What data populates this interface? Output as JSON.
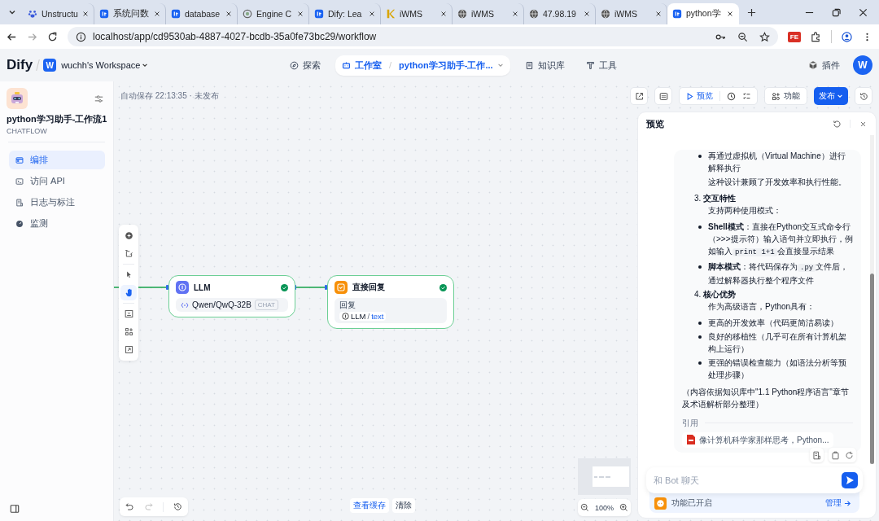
{
  "browser": {
    "tabs": [
      {
        "kind": "paw",
        "title": "Unstructu",
        "selected": false
      },
      {
        "kind": "dify",
        "title": "系统问数",
        "selected": false
      },
      {
        "kind": "dify",
        "title": "database",
        "selected": false
      },
      {
        "kind": "ring",
        "title": "Engine C",
        "selected": false
      },
      {
        "kind": "dify",
        "title": "Dify: Lea",
        "selected": false
      },
      {
        "kind": "k",
        "title": "iWMS",
        "selected": false
      },
      {
        "kind": "globe",
        "title": "iWMS",
        "selected": false
      },
      {
        "kind": "globe",
        "title": "47.98.19",
        "selected": false
      },
      {
        "kind": "globe",
        "title": "iWMS",
        "selected": false
      },
      {
        "kind": "dify",
        "title": "python学",
        "selected": true
      }
    ],
    "url": "localhost/app/cd9530ab-4887-4027-bcdb-35a0fe73bc29/workflow",
    "extension_badge": "FE"
  },
  "header": {
    "logo": "Dify",
    "workspace": {
      "initial": "W",
      "name": "wuchh's Workspace"
    },
    "nav": [
      {
        "kind": "explore",
        "label": "探索",
        "selected": false
      },
      {
        "kind": "studio",
        "label": "工作室",
        "separator": "/",
        "app": "python学习助手-工作...",
        "selected": true
      },
      {
        "kind": "knowledge",
        "label": "知识库",
        "selected": false
      },
      {
        "kind": "tools",
        "label": "工具",
        "selected": false
      }
    ],
    "plugins": "插件",
    "avatar": "W"
  },
  "sidebar": {
    "app_name": "python学习助手-工作流1",
    "app_type": "CHATFLOW",
    "items": [
      {
        "kind": "orchestrate",
        "label": "编排",
        "selected": true
      },
      {
        "kind": "api",
        "label": "访问 API",
        "selected": false
      },
      {
        "kind": "logs",
        "label": "日志与标注",
        "selected": false
      },
      {
        "kind": "monitor",
        "label": "监测",
        "selected": false
      }
    ]
  },
  "canvas": {
    "status": "自动保存 22:13:35 · 未发布",
    "actions": {
      "preview": "预览",
      "features": "功能",
      "publish": "发布"
    },
    "tools": [
      {
        "kind": "add",
        "selected": false
      },
      {
        "kind": "note",
        "selected": false
      },
      {
        "kind": "pointer",
        "selected": false
      },
      {
        "kind": "hand",
        "selected": true
      },
      {
        "kind": "export",
        "selected": false
      },
      {
        "kind": "layout",
        "selected": false
      },
      {
        "kind": "fit",
        "selected": false
      }
    ],
    "nodes": [
      {
        "kind": "llm",
        "title": "LLM",
        "valid": true,
        "model": "Qwen/QwQ-32B",
        "mode": "CHAT"
      },
      {
        "kind": "answer",
        "title": "直接回复",
        "valid": true,
        "field_label": "回复",
        "var_node": "LLM",
        "var_separator": "/",
        "var_name": "text"
      }
    ],
    "view_cache": "查看缓存",
    "clear": "清除",
    "zoom": "100%"
  },
  "preview": {
    "title": "预览",
    "blocks": [
      {
        "kind": "bullet",
        "parts": [
          {
            "kind": "text",
            "text": "再通过虚拟机（Virtual Machine）进行解释执行"
          }
        ]
      },
      {
        "kind": "text",
        "text": "这种设计兼顾了开发效率和执行性能。"
      },
      {
        "kind": "heading",
        "number": "3.",
        "text": "交互特性"
      },
      {
        "kind": "text",
        "text": "支持两种使用模式："
      },
      {
        "kind": "bullet",
        "parts": [
          {
            "kind": "text",
            "text": "**Shell模式**：直接在Python交互式命令行（>>>提示符）输入语句并立即执行，例如输入"
          },
          {
            "kind": "code",
            "text": "print 1+1"
          },
          {
            "kind": "text",
            "text": "会直接显示结果"
          }
        ]
      },
      {
        "kind": "bullet",
        "parts": [
          {
            "kind": "text",
            "text": "**脚本模式**：将代码保存为"
          },
          {
            "kind": "code",
            "text": ".py"
          },
          {
            "kind": "text",
            "text": "文件后，通过解释器执行整个程序文件"
          }
        ]
      },
      {
        "kind": "heading",
        "number": "4.",
        "text": "核心优势"
      },
      {
        "kind": "text",
        "text": "作为高级语言，Python具有："
      },
      {
        "kind": "bullet",
        "parts": [
          {
            "kind": "text",
            "text": "更高的开发效率（代码更简洁易读）"
          }
        ]
      },
      {
        "kind": "bullet",
        "parts": [
          {
            "kind": "text",
            "text": "良好的移植性（几乎可在所有计算机架构上运行）"
          }
        ]
      },
      {
        "kind": "bullet",
        "parts": [
          {
            "kind": "text",
            "text": "更强的错误检查能力（如语法分析等预处理步骤）"
          }
        ]
      },
      {
        "kind": "note",
        "text": "（内容依据知识库中\"1.1 Python程序语言\"章节及术语解析部分整理）"
      }
    ],
    "citation_label": "引用",
    "citation": "像计算机科学家那样思考，Python...",
    "input_placeholder": "和 Bot 聊天",
    "features_status": "功能已开启",
    "manage": "管理"
  }
}
